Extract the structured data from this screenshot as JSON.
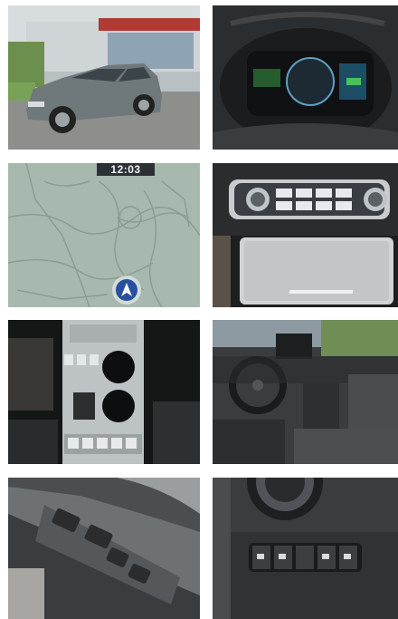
{
  "gallery": {
    "items": [
      {
        "icon": "car-exterior-photo"
      },
      {
        "icon": "instrument-cluster-photo"
      },
      {
        "icon": "navigation-map-photo",
        "clock": "12:03"
      },
      {
        "icon": "climate-control-photo"
      },
      {
        "icon": "center-console-photo"
      },
      {
        "icon": "cockpit-interior-photo"
      },
      {
        "icon": "door-window-switches-photo"
      },
      {
        "icon": "dashboard-switches-photo"
      }
    ]
  },
  "colors": {
    "background": "#ffffff",
    "car_body": "#6f787b",
    "map_bg": "#a7b9ae",
    "nav_arrow": "#2a4ea0"
  }
}
